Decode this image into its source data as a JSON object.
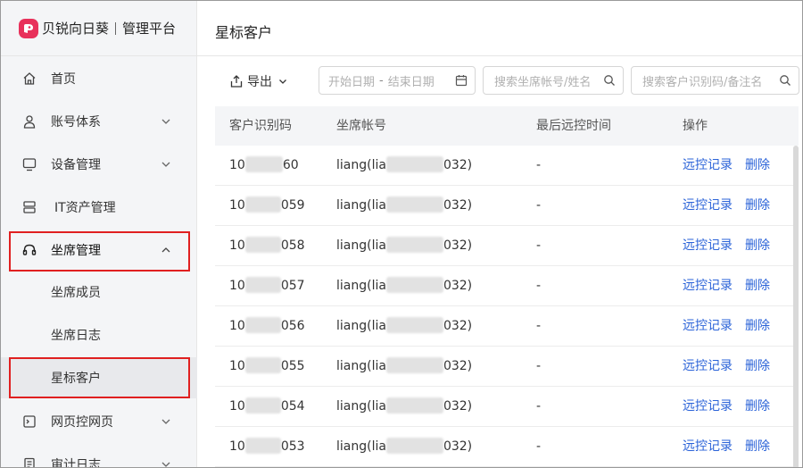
{
  "brand": {
    "name": "贝锐向日葵",
    "section": "管理平台",
    "logo_color": "#e8315b"
  },
  "nav": {
    "items": [
      {
        "label": "首页",
        "icon": "home-icon"
      },
      {
        "label": "账号体系",
        "icon": "user-icon"
      },
      {
        "label": "设备管理",
        "icon": "monitor-icon"
      },
      {
        "label": "IT资产管理",
        "icon": "server-icon"
      },
      {
        "label": "坐席管理",
        "icon": "headset-icon"
      },
      {
        "label": "网页控网页",
        "icon": "terminal-icon"
      },
      {
        "label": "审计日志",
        "icon": "document-icon"
      }
    ],
    "sub_items": [
      {
        "label": "坐席成员"
      },
      {
        "label": "坐席日志"
      },
      {
        "label": "星标客户",
        "active": true
      }
    ],
    "highlight_color": "#e02020"
  },
  "page": {
    "title": "星标客户"
  },
  "toolbar": {
    "export_label": "导出",
    "date_start_placeholder": "开始日期",
    "date_sep": "-",
    "date_end_placeholder": "结束日期",
    "search_agent_placeholder": "搜索坐席帐号/姓名",
    "search_client_placeholder": "搜索客户识别码/备注名"
  },
  "table": {
    "headers": [
      "客户识别码",
      "坐席帐号",
      "最后远控时间",
      "操作"
    ],
    "rows": [
      {
        "code_prefix": "10",
        "code_suffix": "60",
        "agent_prefix": "liang(lia",
        "agent_suffix": "032)",
        "last_time": "-",
        "action_remote": "远控记录",
        "action_delete": "删除"
      },
      {
        "code_prefix": "10",
        "code_suffix": "059",
        "agent_prefix": "liang(lia",
        "agent_suffix": "032)",
        "last_time": "-",
        "action_remote": "远控记录",
        "action_delete": "删除"
      },
      {
        "code_prefix": "10",
        "code_suffix": "058",
        "agent_prefix": "liang(lia",
        "agent_suffix": "032)",
        "last_time": "-",
        "action_remote": "远控记录",
        "action_delete": "删除"
      },
      {
        "code_prefix": "10",
        "code_suffix": "057",
        "agent_prefix": "liang(lia",
        "agent_suffix": "032)",
        "last_time": "-",
        "action_remote": "远控记录",
        "action_delete": "删除"
      },
      {
        "code_prefix": "10",
        "code_suffix": "056",
        "agent_prefix": "liang(lia",
        "agent_suffix": "032)",
        "last_time": "-",
        "action_remote": "远控记录",
        "action_delete": "删除"
      },
      {
        "code_prefix": "10",
        "code_suffix": "055",
        "agent_prefix": "liang(lia",
        "agent_suffix": "032)",
        "last_time": "-",
        "action_remote": "远控记录",
        "action_delete": "删除"
      },
      {
        "code_prefix": "10",
        "code_suffix": "054",
        "agent_prefix": "liang(lia",
        "agent_suffix": "032)",
        "last_time": "-",
        "action_remote": "远控记录",
        "action_delete": "删除"
      },
      {
        "code_prefix": "10",
        "code_suffix": "053",
        "agent_prefix": "liang(lia",
        "agent_suffix": "032)",
        "last_time": "-",
        "action_remote": "远控记录",
        "action_delete": "删除"
      }
    ]
  },
  "colors": {
    "link": "#2b63d8",
    "sidebar_bg": "#f4f5f7",
    "active_bg": "#e8e9ec"
  }
}
